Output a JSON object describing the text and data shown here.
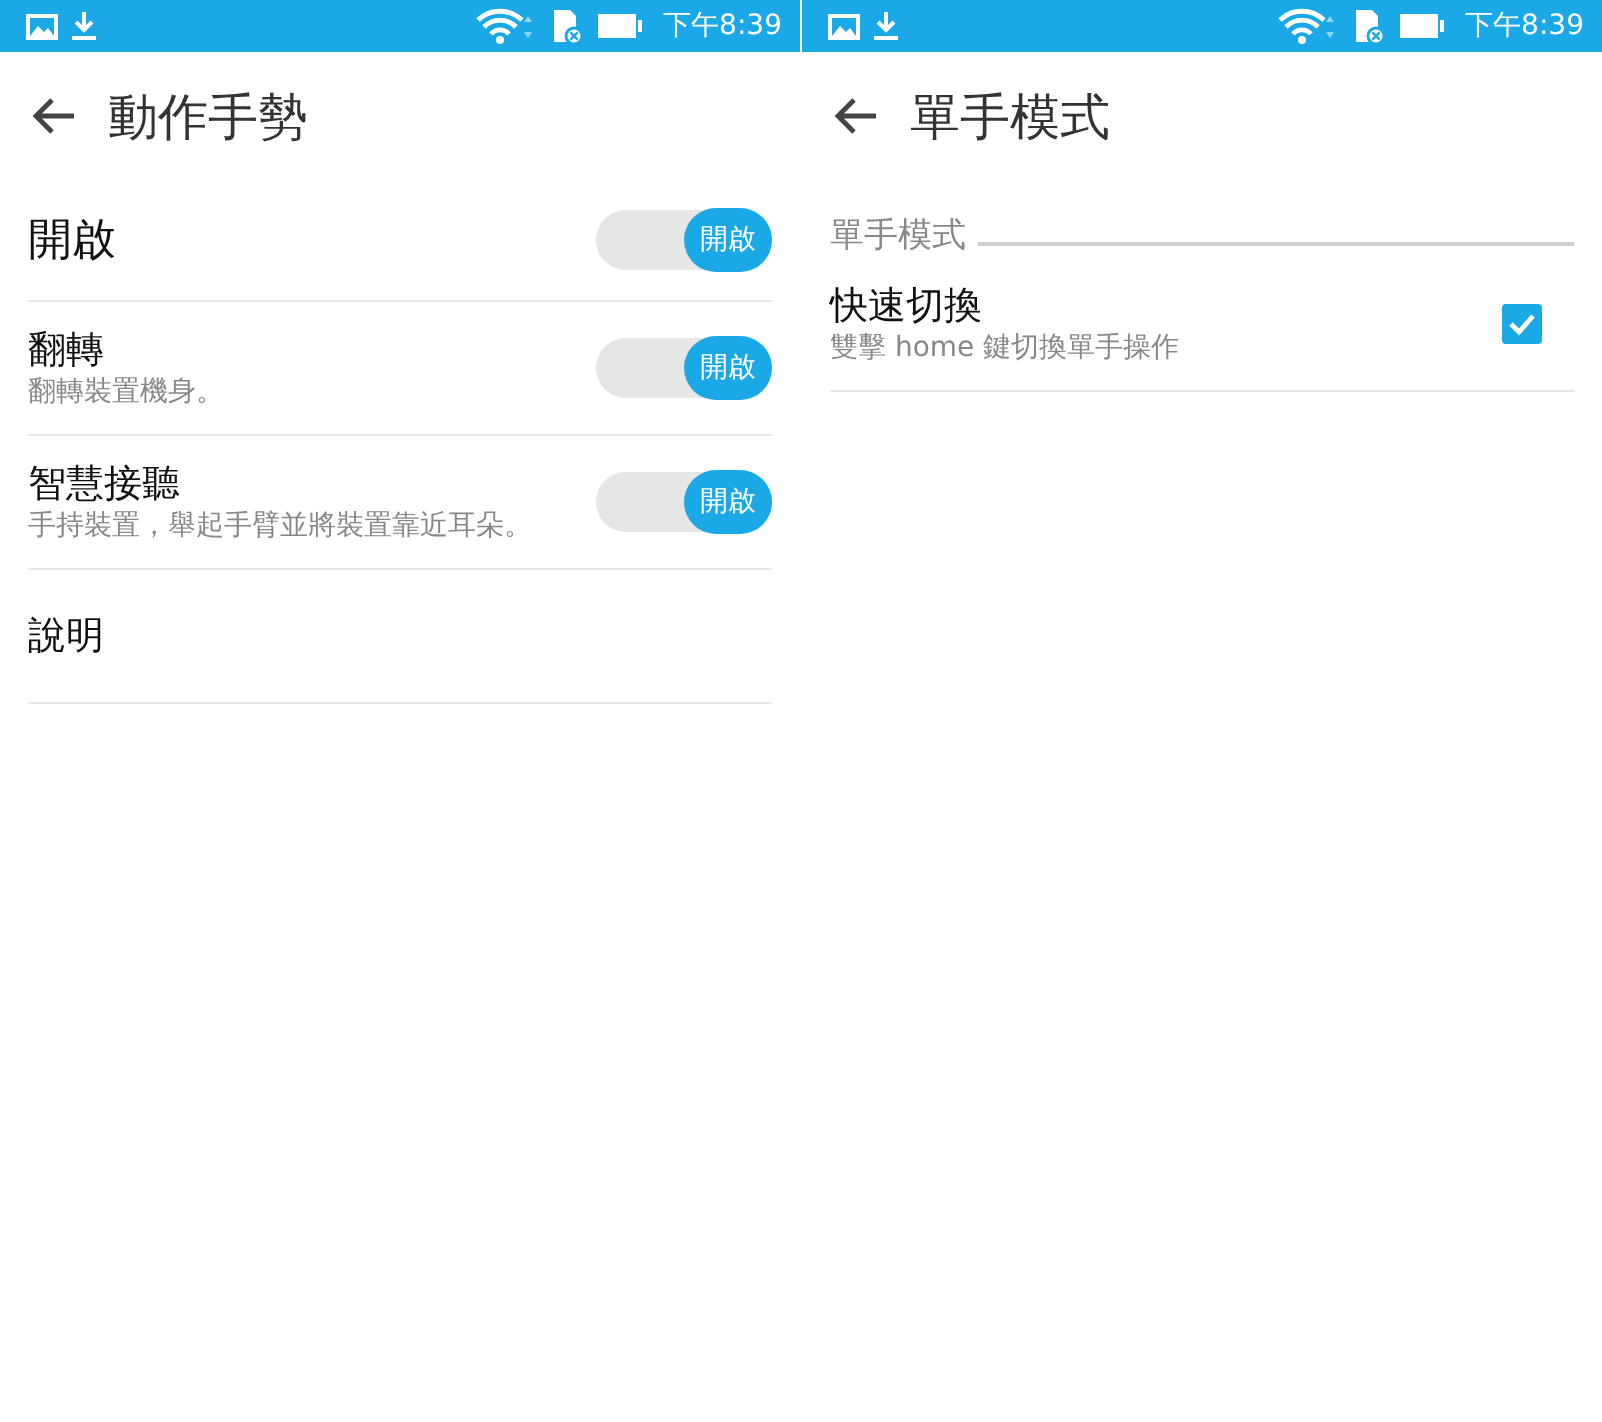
{
  "screens": [
    {
      "status_bar": {
        "time": "下午8:39"
      },
      "title": "動作手勢",
      "items": [
        {
          "kind": "master",
          "title": "開啟",
          "on": true,
          "switch_label": "開啟"
        },
        {
          "kind": "switch",
          "title": "翻轉",
          "subtitle": "翻轉裝置機身。",
          "on": true,
          "switch_label": "開啟"
        },
        {
          "kind": "switch",
          "title": "智慧接聽",
          "subtitle": "手持裝置，舉起手臂並將裝置靠近耳朵。",
          "on": true,
          "switch_label": "開啟"
        },
        {
          "kind": "link",
          "title": "說明"
        }
      ]
    },
    {
      "status_bar": {
        "time": "下午8:39"
      },
      "title": "單手模式",
      "items": [
        {
          "kind": "section",
          "title": "單手模式"
        },
        {
          "kind": "checkbox",
          "title": "快速切換",
          "subtitle": "雙擊 home 鍵切換單手操作",
          "checked": true
        }
      ]
    }
  ]
}
